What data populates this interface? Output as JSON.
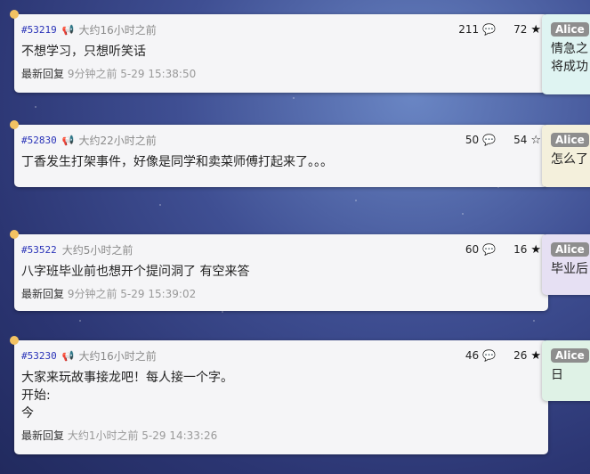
{
  "posts": [
    {
      "id": "#53219",
      "time": "大约16小时之前",
      "comments": "211",
      "likes": "72",
      "starred": true,
      "text": "不想学习，只想听笑话",
      "reply_label": "最新回复",
      "reply_time": "9分钟之前 5-29 15:38:50",
      "megaphone": true
    },
    {
      "id": "#52830",
      "time": "大约22小时之前",
      "comments": "50",
      "likes": "54",
      "starred": false,
      "text": "丁香发生打架事件，好像是同学和卖菜师傅打起来了。。。",
      "reply_label": "",
      "reply_time": "",
      "megaphone": true
    },
    {
      "id": "#53522",
      "time": "大约5小时之前",
      "comments": "60",
      "likes": "16",
      "starred": true,
      "text": "八字班毕业前也想开个提问洞了 有空来答",
      "reply_label": "最新回复",
      "reply_time": "9分钟之前 5-29 15:39:02",
      "megaphone": false
    },
    {
      "id": "#53230",
      "time": "大约16小时之前",
      "comments": "46",
      "likes": "26",
      "starred": true,
      "text": "大家来玩故事接龙吧！每人接一个字。\n开始:\n今",
      "reply_label": "最新回复",
      "reply_time": "大约1小时之前 5-29 14:33:26",
      "megaphone": true
    }
  ],
  "side_replies": [
    {
      "author": "Alice",
      "text": "情急之\n将成功",
      "bg": "#dff4f2"
    },
    {
      "author": "Alice",
      "text": "怎么了",
      "bg": "#f4f0dc"
    },
    {
      "author": "Alice",
      "text": "毕业后",
      "bg": "#e6e0f3"
    },
    {
      "author": "Alice",
      "text": "日",
      "bg": "#dff2e6"
    }
  ],
  "icons": {
    "comment": "comment-bubble-icon",
    "star": "star-icon",
    "megaphone": "megaphone-icon"
  }
}
